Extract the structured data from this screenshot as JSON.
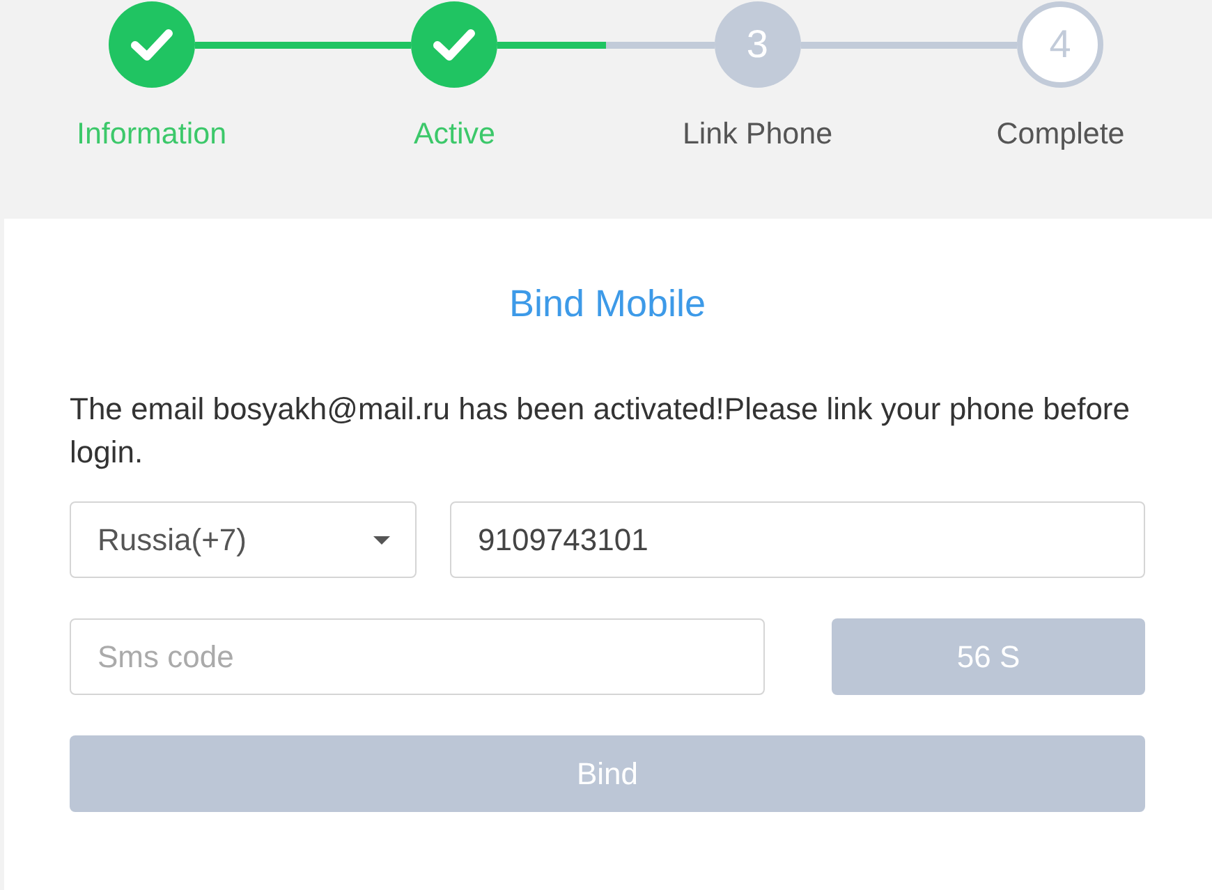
{
  "steps": [
    {
      "label": "Information",
      "completed": true,
      "selected": false
    },
    {
      "label": "Active",
      "completed": true,
      "selected": false
    },
    {
      "label": "Link Phone",
      "number": "3",
      "completed": false,
      "selected": true
    },
    {
      "label": "Complete",
      "number": "4",
      "completed": false,
      "selected": false
    }
  ],
  "card": {
    "title": "Bind Mobile",
    "message": "The email bosyakh@mail.ru has been activated!Please link your phone before login.",
    "country_select": {
      "value": "Russia(+7)"
    },
    "phone_field": {
      "value": "9109743101"
    },
    "sms_field": {
      "placeholder": "Sms code"
    },
    "sms_button": {
      "label": "56 S",
      "disabled": true
    },
    "bind_button": {
      "label": "Bind",
      "disabled": true
    }
  }
}
